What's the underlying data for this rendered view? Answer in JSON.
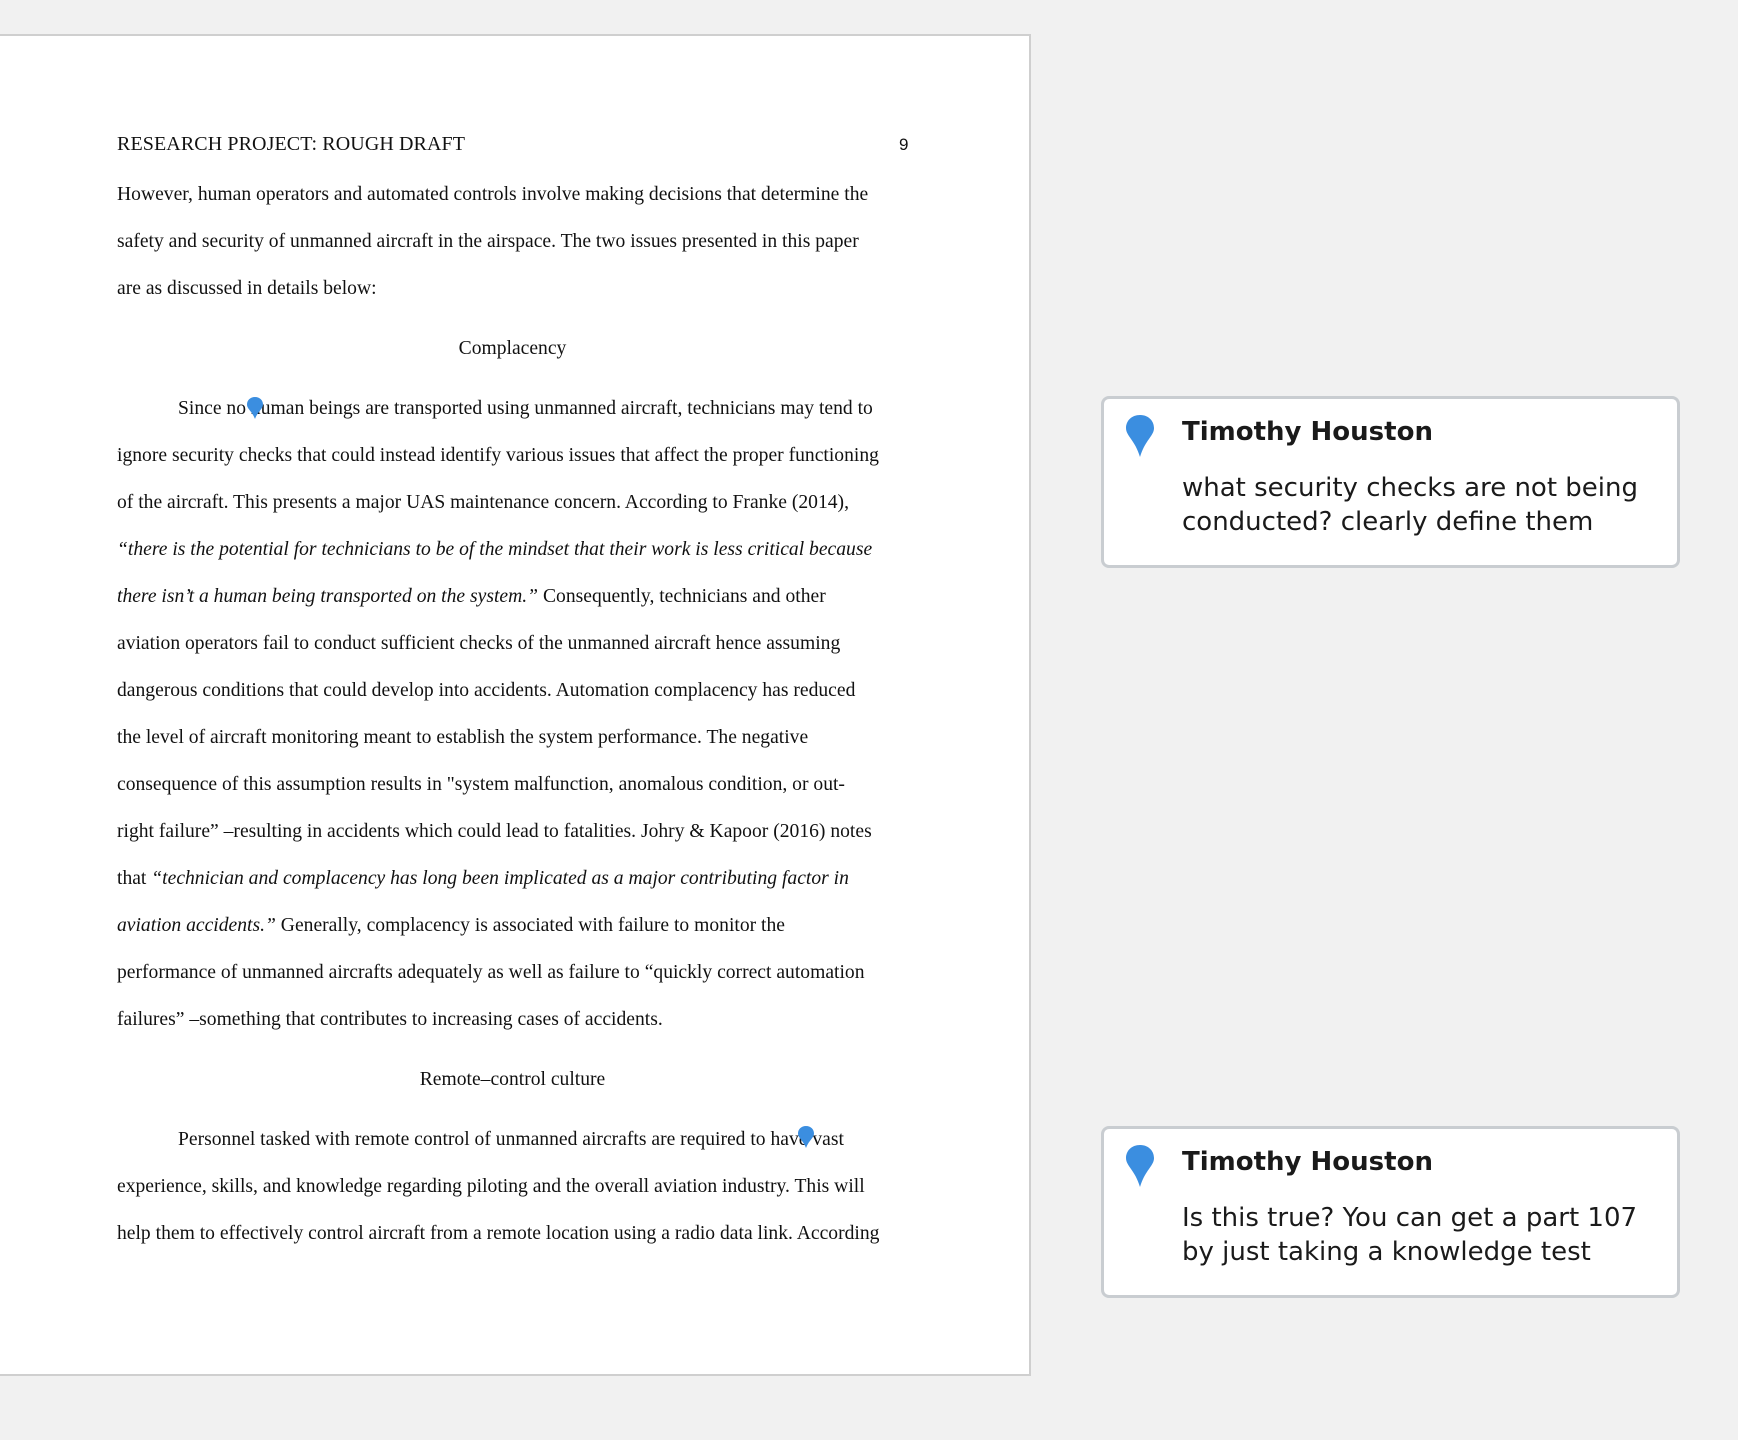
{
  "document": {
    "running_head": "RESEARCH PROJECT: ROUGH DRAFT",
    "page_number": "9",
    "lines": [
      {
        "text": "However, human operators and automated controls involve making decisions that determine the"
      },
      {
        "text": "safety and security of unmanned aircraft in the airspace. The two issues presented in this paper"
      },
      {
        "text": "are as discussed in details below:"
      },
      {
        "text": "Complacency"
      },
      {
        "text": "Since no human beings are transported using unmanned aircraft, technicians may tend to"
      },
      {
        "text": "ignore security checks that could instead identify various issues that affect the proper functioning"
      },
      {
        "text": "of the aircraft. This presents a major UAS maintenance concern. According to Franke (2014),"
      },
      {
        "italic": "“there is the potential for technicians to be of the mindset that their work is less critical because"
      },
      {
        "italic": "there isn’t a human being transported on the system.”",
        "after": " Consequently, technicians and other"
      },
      {
        "text": "aviation operators fail to conduct sufficient checks of the unmanned aircraft hence assuming"
      },
      {
        "text": "dangerous conditions that could develop into accidents. Automation complacency has reduced"
      },
      {
        "text": "the level of aircraft monitoring meant to establish the system performance. The negative"
      },
      {
        "text": "consequence of this assumption results in \"system malfunction, anomalous condition, or out-"
      },
      {
        "text": "right failure” –resulting in accidents which could lead to fatalities. Johry & Kapoor (2016) notes"
      },
      {
        "before": "that ",
        "italic": "“technician and complacency has long been implicated as a major contributing factor in"
      },
      {
        "italic": "aviation accidents.”",
        "after": " Generally, complacency is associated with failure to monitor the"
      },
      {
        "text": "performance of unmanned aircrafts adequately as well as failure to “quickly correct automation"
      },
      {
        "text": "failures” –something that contributes to increasing cases of accidents."
      },
      {
        "text": "Remote–control culture"
      },
      {
        "text": "Personnel tasked with remote control of unmanned aircrafts are required to have vast"
      },
      {
        "text": "experience, skills, and knowledge regarding piloting and the overall aviation industry. This will"
      },
      {
        "text": "help them to effectively control aircraft from a remote location using a radio data link. According"
      }
    ]
  },
  "comments": [
    {
      "author": "Timothy Houston",
      "text": "what security checks are not being conducted? clearly define them"
    },
    {
      "author": "Timothy Houston",
      "text": "Is this true? You can get a part 107 by just taking a knowledge test"
    }
  ],
  "colors": {
    "pin": "#3b8ee0",
    "card_border": "#c9cdd1",
    "background": "#f1f1f1"
  }
}
